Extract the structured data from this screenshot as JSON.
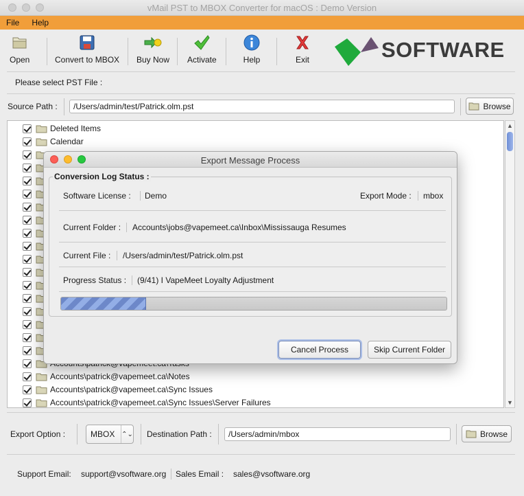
{
  "window": {
    "title": "vMail PST to MBOX Converter for macOS : Demo Version"
  },
  "menu": {
    "file": "File",
    "help": "Help"
  },
  "toolbar": {
    "open": "Open",
    "convert": "Convert to MBOX",
    "buy": "Buy Now",
    "activate": "Activate",
    "help": "Help",
    "exit": "Exit"
  },
  "logo": {
    "text": "SOFTWARE"
  },
  "source": {
    "prompt": "Please select PST File :",
    "label": "Source Path :",
    "value": "/Users/admin/test/Patrick.olm.pst",
    "browse": "Browse"
  },
  "tree": {
    "items": [
      {
        "label": "Deleted Items",
        "checked": true
      },
      {
        "label": "Calendar",
        "checked": true
      },
      {
        "label": "Contacts",
        "checked": true
      },
      {
        "label": "",
        "checked": true
      },
      {
        "label": "",
        "checked": true
      },
      {
        "label": "",
        "checked": true
      },
      {
        "label": "",
        "checked": true
      },
      {
        "label": "",
        "checked": true
      },
      {
        "label": "",
        "checked": true
      },
      {
        "label": "",
        "checked": true
      },
      {
        "label": "",
        "checked": true
      },
      {
        "label": "",
        "checked": true
      },
      {
        "label": "",
        "checked": true
      },
      {
        "label": "",
        "checked": true
      },
      {
        "label": "",
        "checked": true
      },
      {
        "label": "",
        "checked": true
      },
      {
        "label": "",
        "checked": true
      },
      {
        "label": "",
        "checked": true
      },
      {
        "label": "Accounts\\patrick@vapemeet.ca\\Tasks",
        "checked": true
      },
      {
        "label": "Accounts\\patrick@vapemeet.ca\\Notes",
        "checked": true
      },
      {
        "label": "Accounts\\patrick@vapemeet.ca\\Sync Issues",
        "checked": true
      },
      {
        "label": "Accounts\\patrick@vapemeet.ca\\Sync Issues\\Server Failures",
        "checked": true
      }
    ]
  },
  "export": {
    "option_label": "Export Option :",
    "option_value": "MBOX",
    "dest_label": "Destination Path :",
    "dest_value": "/Users/admin/mbox",
    "browse": "Browse"
  },
  "footer": {
    "support_label": "Support Email:",
    "support_value": "support@vsoftware.org",
    "sales_label": "Sales Email :",
    "sales_value": "sales@vsoftware.org"
  },
  "dialog": {
    "title": "Export Message Process",
    "group_title": "Conversion Log Status :",
    "license_label": "Software License  :",
    "license_value": "Demo",
    "mode_label": "Export Mode :",
    "mode_value": "mbox",
    "folder_label": "Current Folder :",
    "folder_value": "Accounts\\jobs@vapemeet.ca\\Inbox\\Mississauga Resumes",
    "file_label": "Current File :",
    "file_value": "/Users/admin/test/Patrick.olm.pst",
    "progress_label": "Progress Status :",
    "progress_value": "(9/41) I VapeMeet Loyalty Adjustment",
    "progress_fraction": 0.22,
    "cancel": "Cancel Process",
    "skip": "Skip Current Folder"
  },
  "colors": {
    "menubar": "#f19e3a",
    "logo_green": "#1faa3c",
    "logo_purple": "#6a5272",
    "progress": "#6d88c9"
  }
}
